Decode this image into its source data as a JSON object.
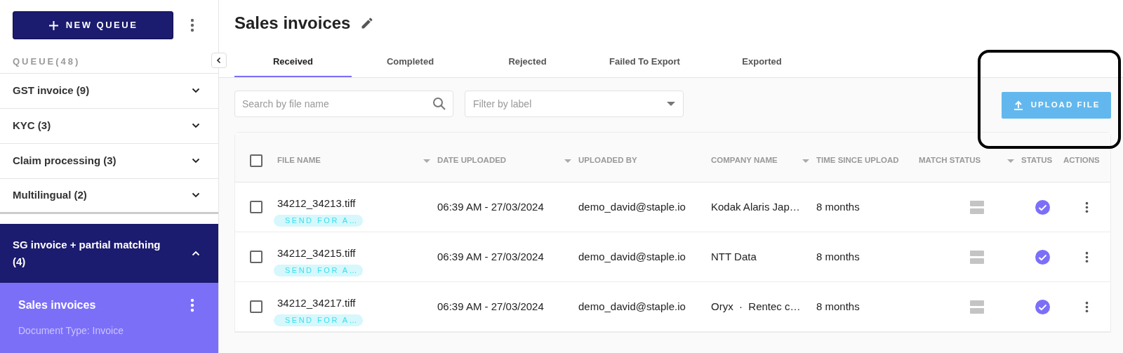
{
  "sidebar": {
    "new_queue_button": "NEW QUEUE",
    "queue_heading": "QUEUE(48)",
    "queues": [
      {
        "label": "GST invoice (9)",
        "expanded": false
      },
      {
        "label": "KYC (3)",
        "expanded": false
      },
      {
        "label": "Claim processing (3)",
        "expanded": false
      },
      {
        "label": "Multilingual (2)",
        "expanded": false
      },
      {
        "label": "SG invoice + partial matching (4)",
        "expanded": true,
        "children": [
          {
            "label": "Sales invoices",
            "subtitle": "Document Type: Invoice",
            "selected": true
          }
        ]
      }
    ]
  },
  "main": {
    "title": "Sales invoices",
    "tabs": [
      {
        "label": "Received",
        "selected": true
      },
      {
        "label": "Completed",
        "selected": false
      },
      {
        "label": "Rejected",
        "selected": false
      },
      {
        "label": "Failed To Export",
        "selected": false
      },
      {
        "label": "Exported",
        "selected": false
      }
    ],
    "search": {
      "placeholder": "Search by file name"
    },
    "filter": {
      "placeholder": "Filter by label"
    },
    "upload_button": "UPLOAD FILE",
    "table": {
      "all_checked": false,
      "columns": [
        {
          "label": "FILE NAME",
          "sortable": true
        },
        {
          "label": "DATE UPLOADED",
          "sortable": true
        },
        {
          "label": "UPLOADED BY",
          "sortable": false
        },
        {
          "label": "COMPANY NAME",
          "sortable": true
        },
        {
          "label": "TIME SINCE UPLOAD",
          "sortable": false
        },
        {
          "label": "MATCH STATUS",
          "sortable": true
        },
        {
          "label": "STATUS",
          "sortable": false
        },
        {
          "label": "ACTIONS",
          "sortable": false
        }
      ],
      "rows": [
        {
          "checked": false,
          "file_name": "34212_34213.tiff",
          "tag": "SEND FOR A…",
          "date": "06:39 AM - 27/03/2024",
          "uploaded_by": "demo_david@staple.io",
          "company": "Kodak Alaris Jap…",
          "time_since": "8 months",
          "verified": true
        },
        {
          "checked": false,
          "file_name": "34212_34215.tiff",
          "tag": "SEND FOR A…",
          "date": "06:39 AM - 27/03/2024",
          "uploaded_by": "demo_david@staple.io",
          "company": "NTT Data",
          "time_since": "8 months",
          "verified": true
        },
        {
          "checked": false,
          "file_name": "34212_34217.tiff",
          "tag": "SEND FOR A…",
          "date": "06:39 AM - 27/03/2024",
          "uploaded_by": "demo_david@staple.io",
          "company": "Oryx  ·  Rentec c…",
          "time_since": "8 months",
          "verified": true
        }
      ]
    }
  }
}
